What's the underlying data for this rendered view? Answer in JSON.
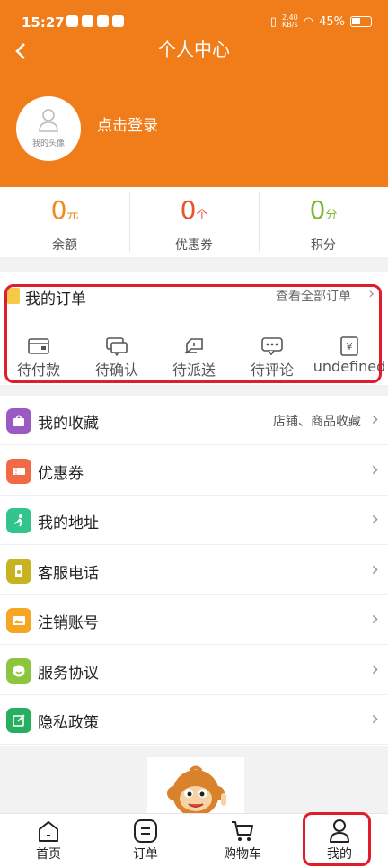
{
  "status_bar": {
    "time": "15:27",
    "net_speed": "2.40\nKB/s",
    "battery": "45%"
  },
  "header": {
    "title": "个人中心",
    "login_text": "点击登录",
    "avatar_label": "我的头像"
  },
  "stats": [
    {
      "value": "0",
      "unit": "元",
      "label": "余额",
      "color": "#f08a1c"
    },
    {
      "value": "0",
      "unit": "个",
      "label": "优惠券",
      "color": "#e8532b"
    },
    {
      "value": "0",
      "unit": "分",
      "label": "积分",
      "color": "#7cb82f"
    }
  ],
  "orders": {
    "title": "我的订单",
    "view_all": "查看全部订单",
    "items": [
      "待付款",
      "待确认",
      "待派送",
      "待评论",
      "undefined"
    ]
  },
  "menu": [
    {
      "label": "我的收藏",
      "extra": "店铺、商品收藏",
      "icon": "favorites-icon",
      "color": "#9b59c4"
    },
    {
      "label": "优惠券",
      "extra": "",
      "icon": "coupon-icon",
      "color": "#f06a45"
    },
    {
      "label": "我的地址",
      "extra": "",
      "icon": "address-icon",
      "color": "#31c48d"
    },
    {
      "label": "客服电话",
      "extra": "",
      "icon": "phone-icon",
      "color": "#c7b320"
    },
    {
      "label": "注销账号",
      "extra": "",
      "icon": "account-icon",
      "color": "#f5a623"
    },
    {
      "label": "服务协议",
      "extra": "",
      "icon": "agreement-icon",
      "color": "#8cc63f"
    },
    {
      "label": "隐私政策",
      "extra": "",
      "icon": "privacy-icon",
      "color": "#27ae60"
    }
  ],
  "tabbar": [
    "首页",
    "订单",
    "购物车",
    "我的"
  ]
}
